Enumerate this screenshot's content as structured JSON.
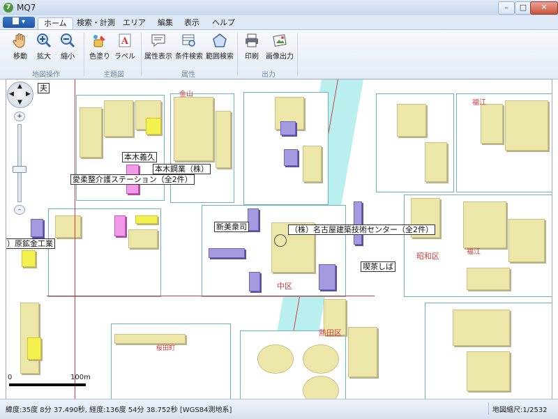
{
  "window": {
    "title": "MQ7",
    "app_icon_glyph": "7",
    "min_glyph": "–",
    "max_glyph": "□",
    "close_glyph": "✕"
  },
  "ribbon": {
    "app_menu_label": "▾",
    "tabs": [
      {
        "label": "ホーム",
        "active": true
      },
      {
        "label": "検索・計測"
      },
      {
        "label": "エリア"
      },
      {
        "label": "編集"
      },
      {
        "label": "表示"
      },
      {
        "label": "ヘルプ"
      }
    ],
    "groups": [
      {
        "label": "地図操作",
        "buttons": [
          {
            "label": "移動",
            "icon": "hand-icon"
          },
          {
            "label": "拡大",
            "icon": "zoom-in-icon"
          },
          {
            "label": "縮小",
            "icon": "zoom-out-icon"
          }
        ]
      },
      {
        "label": "主題図",
        "buttons": [
          {
            "label": "色塗り",
            "icon": "paint-icon"
          },
          {
            "label": "ラベル",
            "icon": "label-icon"
          }
        ]
      },
      {
        "label": "属性",
        "buttons": [
          {
            "label": "属性表示",
            "icon": "speech-icon"
          },
          {
            "label": "条件検索",
            "icon": "table-search-icon"
          },
          {
            "label": "範囲検索",
            "icon": "pentagon-icon"
          }
        ]
      },
      {
        "label": "出力",
        "buttons": [
          {
            "label": "印刷",
            "icon": "printer-icon"
          },
          {
            "label": "画像出力",
            "icon": "image-export-icon"
          }
        ]
      }
    ]
  },
  "map": {
    "labels": {
      "partial_top": "夫",
      "honki": "本木義久",
      "honki_kogyo": "本木鋼業（株）",
      "aiju": "愛柔整介護ステーション（全2件）",
      "shinbi": "新美衆司",
      "nagoya_kenchiku": "（株）名古屋建築技術センター（全2件）",
      "kissa": "喫茶しば",
      "hara": "）原鉱金工業"
    },
    "red_text": {
      "kanayama": "金山",
      "fukue_top": "福江",
      "showa": "昭和区",
      "fukue_mid": "福江",
      "naka": "中区",
      "atsuta": "熱田区",
      "kuwata": "桜田町"
    },
    "scale": {
      "zero": "0",
      "distance": "100m"
    }
  },
  "status": {
    "coords": "緯度:35度 8分 37.490秒, 経度:136度 54分 38.752秒 [WGS84測地系]",
    "scale": "地図縮尺:1/2532"
  }
}
